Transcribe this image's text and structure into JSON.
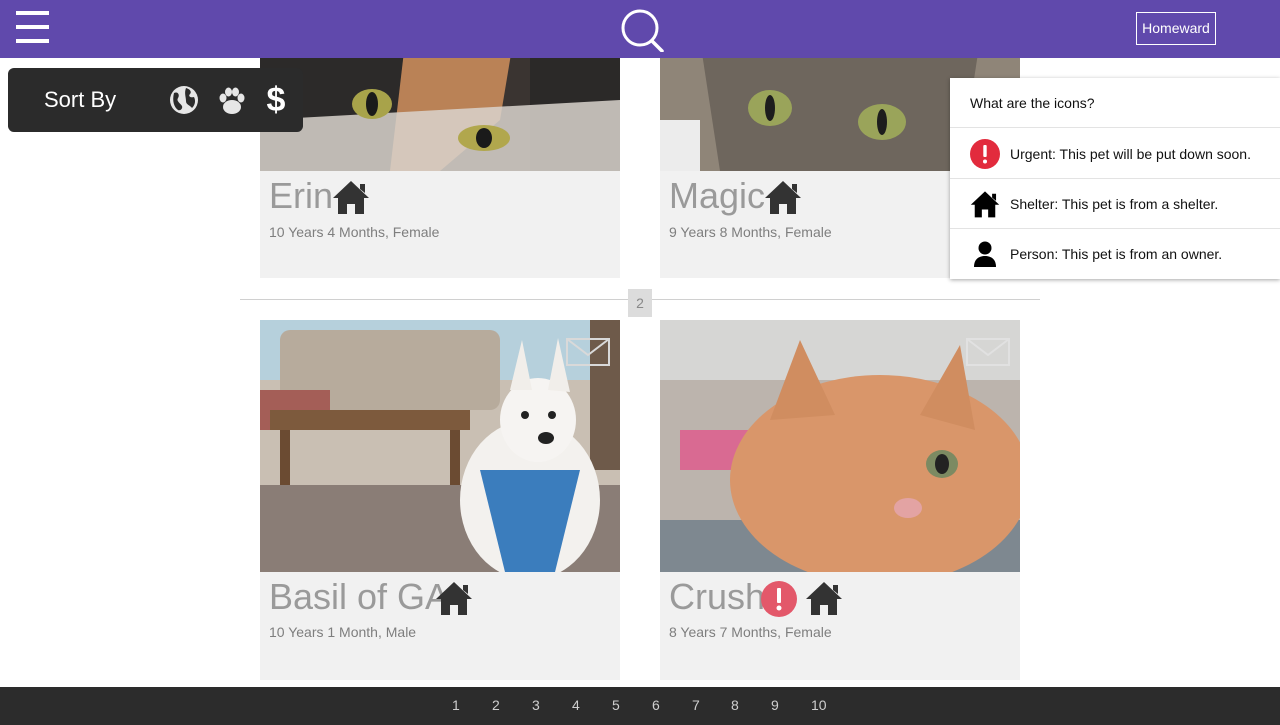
{
  "header": {
    "menu_icon": "hamburger-menu-icon",
    "search_icon": "search-icon",
    "brand_label": "Homeward",
    "accent": "#6049ac"
  },
  "sort": {
    "label": "Sort By",
    "icons": [
      "globe-icon",
      "paw-icon",
      "dollar-icon"
    ],
    "dollar_glyph": "$"
  },
  "pets": [
    {
      "name": "Erin",
      "meta": "10 Years 4 Months, Female",
      "badges": [
        "shelter"
      ]
    },
    {
      "name": "Magic",
      "meta": "9 Years 8 Months, Female",
      "badges": [
        "shelter"
      ]
    },
    {
      "name": "Basil of GA",
      "meta": "10 Years 1 Month, Male",
      "badges": [
        "shelter"
      ]
    },
    {
      "name": "Crush",
      "meta": "8 Years 7 Months, Female",
      "badges": [
        "urgent",
        "shelter"
      ]
    }
  ],
  "section_page": "2",
  "legend": {
    "title": "What are the icons?",
    "items": [
      {
        "icon": "urgent-icon",
        "text": "Urgent: This pet will be put down soon."
      },
      {
        "icon": "house-icon",
        "text": "Shelter: This pet is from a shelter."
      },
      {
        "icon": "person-icon",
        "text": "Person: This pet is from an owner."
      }
    ],
    "urgent_color": "#e33e4e"
  },
  "pagination": [
    "1",
    "2",
    "3",
    "4",
    "5",
    "6",
    "7",
    "8",
    "9",
    "10"
  ]
}
